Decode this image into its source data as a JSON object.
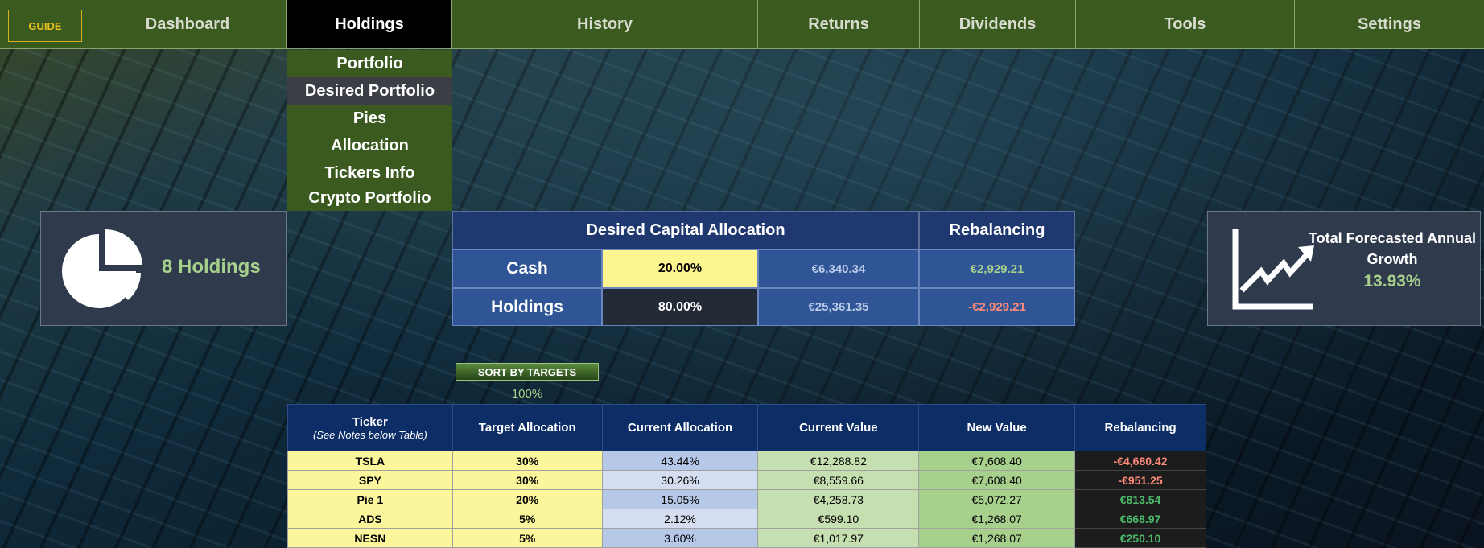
{
  "nav": {
    "guide": "GUIDE",
    "items": [
      "Dashboard",
      "Holdings",
      "History",
      "Returns",
      "Dividends",
      "Tools",
      "Settings"
    ]
  },
  "dropdown": {
    "items": [
      "Portfolio",
      "Desired Portfolio",
      "Pies",
      "Allocation",
      "Tickers Info",
      "Crypto Portfolio"
    ],
    "selected": "Desired Portfolio"
  },
  "holdings_card": {
    "label": "8 Holdings",
    "icon": "pie-chart-icon"
  },
  "allocation": {
    "title": "Desired Capital Allocation",
    "rebalancing_title": "Rebalancing",
    "rows": [
      {
        "label": "Cash",
        "pct": "20.00%",
        "value": "€6,340.34",
        "rebalancing": "€2,929.21"
      },
      {
        "label": "Holdings",
        "pct": "80.00%",
        "value": "€25,361.35",
        "rebalancing": "-€2,929.21"
      }
    ]
  },
  "growth_card": {
    "label": "Total Forecasted Annual Growth",
    "value": "13.93%",
    "icon": "growth-chart-icon"
  },
  "sort": {
    "button": "SORT BY TARGETS",
    "total": "100%"
  },
  "table": {
    "headers": {
      "ticker": "Ticker",
      "ticker_note": "(See Notes below Table)",
      "target": "Target Allocation",
      "current": "Current Allocation",
      "value": "Current Value",
      "new_value": "New Value",
      "rebalancing": "Rebalancing"
    },
    "rows": [
      {
        "ticker": "TSLA",
        "target": "30%",
        "current": "43.44%",
        "value": "€12,288.82",
        "new_value": "€7,608.40",
        "rebalancing": "-€4,680.42"
      },
      {
        "ticker": "SPY",
        "target": "30%",
        "current": "30.26%",
        "value": "€8,559.66",
        "new_value": "€7,608.40",
        "rebalancing": "-€951.25"
      },
      {
        "ticker": "Pie 1",
        "target": "20%",
        "current": "15.05%",
        "value": "€4,258.73",
        "new_value": "€5,072.27",
        "rebalancing": "€813.54"
      },
      {
        "ticker": "ADS",
        "target": "5%",
        "current": "2.12%",
        "value": "€599.10",
        "new_value": "€1,268.07",
        "rebalancing": "€668.97"
      },
      {
        "ticker": "NESN",
        "target": "5%",
        "current": "3.60%",
        "value": "€1,017.97",
        "new_value": "€1,268.07",
        "rebalancing": "€250.10"
      }
    ]
  },
  "colors": {
    "nav_bg": "#3a5a1f",
    "header_blue": "#0d2d66",
    "yellow": "#fbf59b",
    "negative": "#ff8b7a",
    "positive": "#4cba6a"
  }
}
